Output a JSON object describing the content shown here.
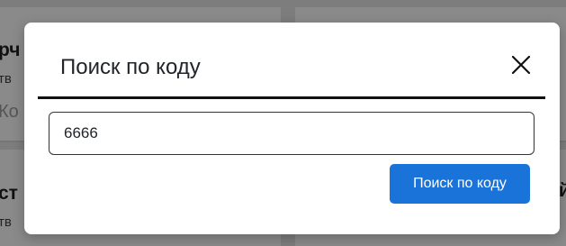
{
  "background": {
    "top_left_heading": "рч",
    "top_left_sub": "тв",
    "top_left_faint": "Ко",
    "bottom_left_heading": "ст",
    "bottom_left_sub": "тв",
    "bottom_right_heading": "й"
  },
  "modal": {
    "title": "Поиск по коду",
    "close_icon": "close-icon",
    "input_value": "6666",
    "search_label": "Поиск по коду"
  },
  "colors": {
    "overlay": "#7d7d7d",
    "modal_bg": "#ffffff",
    "primary_button": "#1a73d9"
  }
}
